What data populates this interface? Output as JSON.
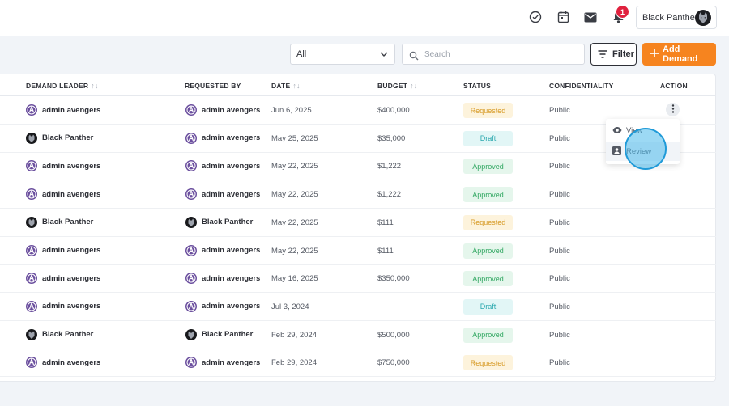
{
  "header": {
    "user_name": "Black Panther",
    "notification_count": "1",
    "icons": [
      "check-circle-icon",
      "calendar-icon",
      "mail-icon",
      "bell-icon"
    ]
  },
  "filters": {
    "select_value": "All",
    "search_placeholder": "Search",
    "filter_label": "Filter",
    "add_label": "Add Demand"
  },
  "table": {
    "columns": {
      "demand_leader": "DEMAND LEADER",
      "requested_by": "REQUESTED BY",
      "date": "DATE",
      "budget": "BUDGET",
      "status": "STATUS",
      "confidentiality": "CONFIDENTIALITY",
      "action": "ACTION"
    },
    "sort_glyph": "↑↓",
    "rows": [
      {
        "leader": "admin avengers",
        "requested_by": "admin avengers",
        "date": "Jun 6, 2025",
        "budget": "$400,000",
        "status": "Requested",
        "confidentiality": "Public"
      },
      {
        "leader": "Black Panther",
        "requested_by": "admin avengers",
        "date": "May 25, 2025",
        "budget": "$35,000",
        "status": "Draft",
        "confidentiality": "Public"
      },
      {
        "leader": "admin avengers",
        "requested_by": "admin avengers",
        "date": "May 22, 2025",
        "budget": "$1,222",
        "status": "Approved",
        "confidentiality": "Public"
      },
      {
        "leader": "admin avengers",
        "requested_by": "admin avengers",
        "date": "May 22, 2025",
        "budget": "$1,222",
        "status": "Approved",
        "confidentiality": "Public"
      },
      {
        "leader": "Black Panther",
        "requested_by": "Black Panther",
        "date": "May 22, 2025",
        "budget": "$111",
        "status": "Requested",
        "confidentiality": "Public"
      },
      {
        "leader": "admin avengers",
        "requested_by": "admin avengers",
        "date": "May 22, 2025",
        "budget": "$111",
        "status": "Approved",
        "confidentiality": "Public"
      },
      {
        "leader": "admin avengers",
        "requested_by": "admin avengers",
        "date": "May 16, 2025",
        "budget": "$350,000",
        "status": "Approved",
        "confidentiality": "Public"
      },
      {
        "leader": "admin avengers",
        "requested_by": "admin avengers",
        "date": "Jul 3, 2024",
        "budget": "",
        "status": "Draft",
        "confidentiality": "Public"
      },
      {
        "leader": "Black Panther",
        "requested_by": "Black Panther",
        "date": "Feb 29, 2024",
        "budget": "$500,000",
        "status": "Approved",
        "confidentiality": "Public"
      },
      {
        "leader": "admin avengers",
        "requested_by": "admin avengers",
        "date": "Feb 29, 2024",
        "budget": "$750,000",
        "status": "Requested",
        "confidentiality": "Public"
      }
    ]
  },
  "action_menu": {
    "view_label": "View",
    "review_label": "Review"
  },
  "colors": {
    "accent": "#f6841f",
    "badge": "#e0213e",
    "requested": "#d79a25",
    "draft": "#2ba8ae",
    "approved": "#33a863"
  }
}
